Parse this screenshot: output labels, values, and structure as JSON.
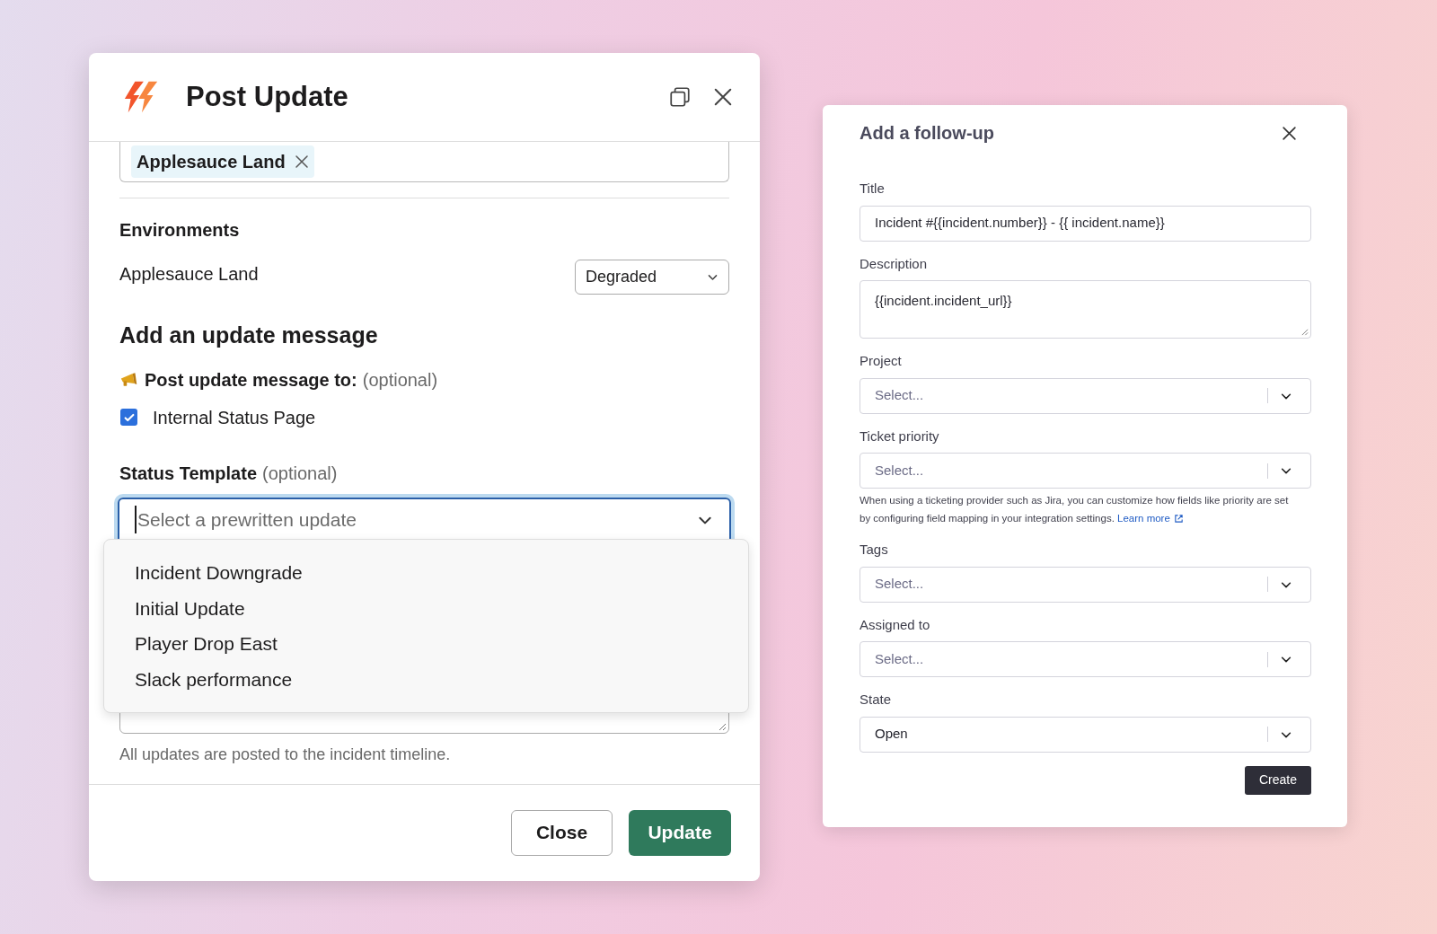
{
  "post_update": {
    "title": "Post Update",
    "tag_field": {
      "tags": [
        {
          "label": "Applesauce Land"
        }
      ]
    },
    "environments": {
      "heading": "Environments",
      "rows": [
        {
          "name": "Applesauce Land",
          "value": "Degraded"
        }
      ]
    },
    "update_message": {
      "heading": "Add an update message",
      "post_to": {
        "label": "Post update message to:",
        "note": "(optional)"
      },
      "destinations": [
        {
          "label": "Internal Status Page",
          "checked": true
        }
      ],
      "template": {
        "label": "Status Template",
        "note": "(optional)",
        "placeholder": "Select a prewritten update",
        "expanded": true,
        "options": [
          {
            "label": "Incident Downgrade"
          },
          {
            "label": "Initial Update"
          },
          {
            "label": "Player Drop East"
          },
          {
            "label": "Slack performance"
          }
        ]
      },
      "helper": "All updates are posted to the incident timeline."
    },
    "buttons": [
      {
        "label": "Close",
        "kind": "secondary"
      },
      {
        "label": "Update",
        "kind": "primary"
      }
    ]
  },
  "follow_up": {
    "title": "Add a follow-up",
    "fields": [
      {
        "label": "Title",
        "kind": "text",
        "value": "Incident #{{incident.number}} - {{ incident.name}}"
      },
      {
        "label": "Description",
        "kind": "textarea",
        "value": "{{incident.incident_url}}"
      },
      {
        "label": "Project",
        "kind": "select",
        "placeholder": "Select..."
      },
      {
        "label": "Ticket priority",
        "kind": "select",
        "placeholder": "Select...",
        "help": "When using a ticketing provider such as Jira, you can customize how fields like priority are set by configuring field mapping in your integration settings.",
        "help_link": "Learn more"
      },
      {
        "label": "Tags",
        "kind": "select",
        "placeholder": "Select..."
      },
      {
        "label": "Assigned to",
        "kind": "select",
        "placeholder": "Select..."
      },
      {
        "label": "State",
        "kind": "select",
        "value": "Open"
      }
    ],
    "buttons": [
      {
        "label": "Create",
        "kind": "primary"
      }
    ]
  }
}
